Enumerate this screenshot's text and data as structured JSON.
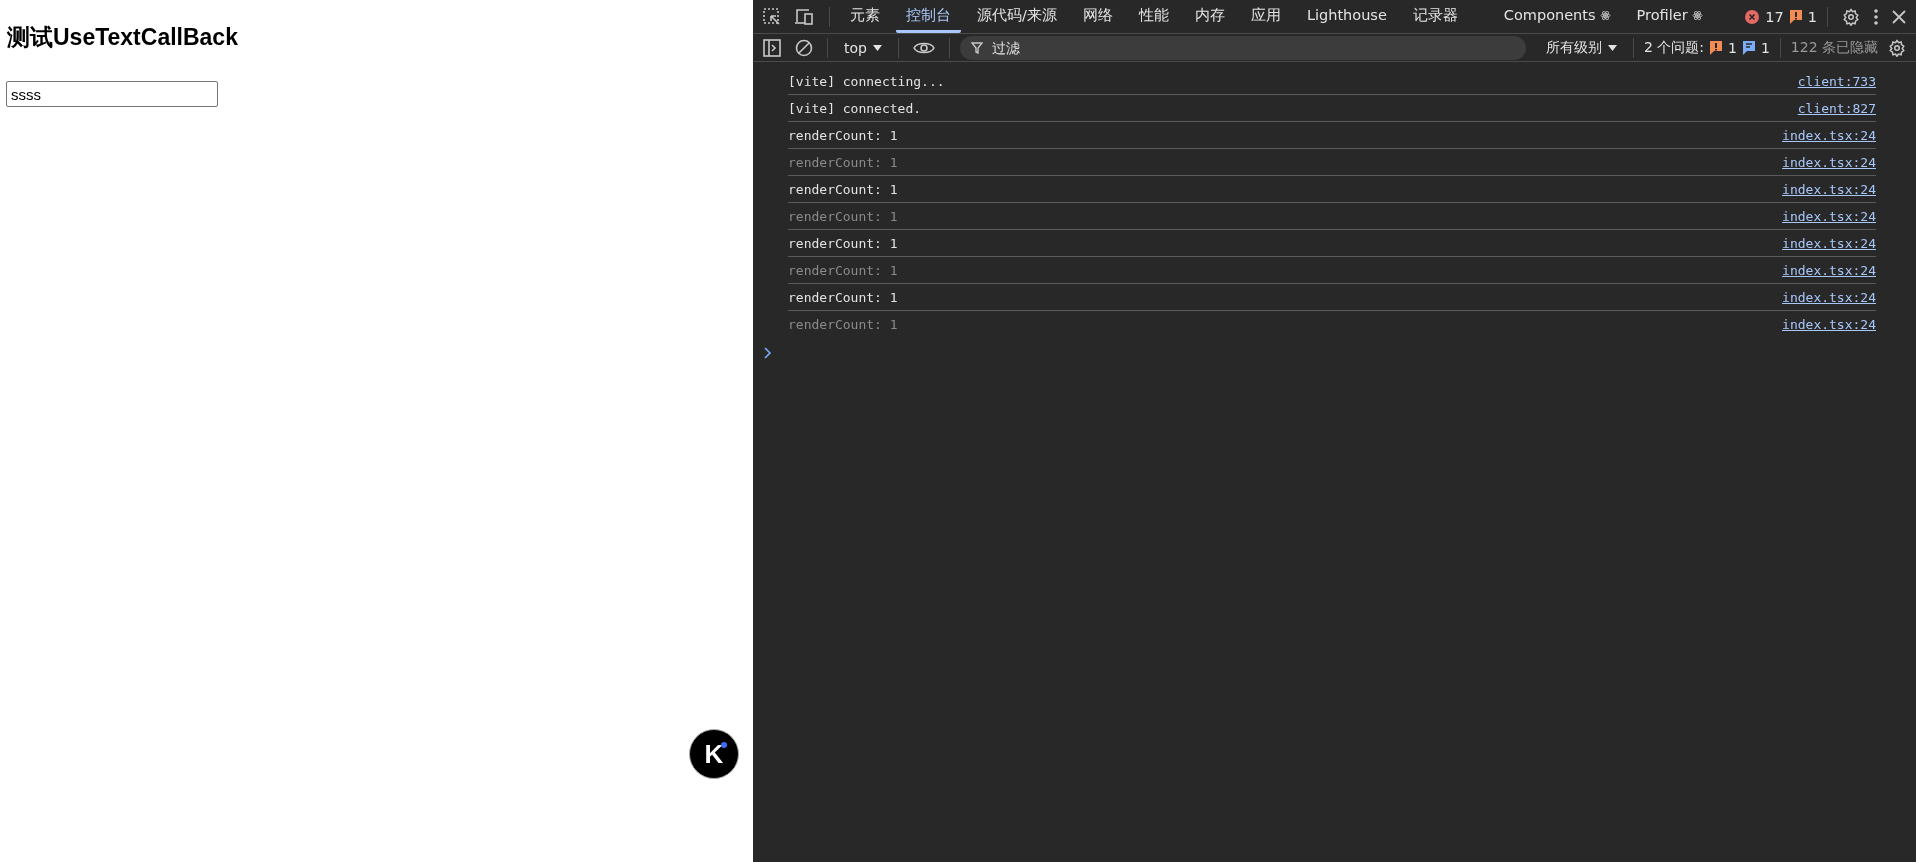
{
  "page": {
    "heading": "测试UseTextCallBack",
    "input_value": "ssss",
    "float_button": {
      "label": "K"
    }
  },
  "devtools": {
    "tabs": [
      {
        "label": "元素",
        "selected": false,
        "react": false
      },
      {
        "label": "控制台",
        "selected": true,
        "react": false
      },
      {
        "label": "源代码/来源",
        "selected": false,
        "react": false
      },
      {
        "label": "网络",
        "selected": false,
        "react": false
      },
      {
        "label": "性能",
        "selected": false,
        "react": false
      },
      {
        "label": "内存",
        "selected": false,
        "react": false
      },
      {
        "label": "应用",
        "selected": false,
        "react": false
      },
      {
        "label": "Lighthouse",
        "selected": false,
        "react": false
      },
      {
        "label": "记录器",
        "selected": false,
        "react": false
      },
      {
        "label": "Components",
        "selected": false,
        "react": true
      },
      {
        "label": "Profiler",
        "selected": false,
        "react": true
      }
    ],
    "error_count": "17",
    "warning_count": "1",
    "toolbar": {
      "context": "top",
      "filter_placeholder": "过滤",
      "levels": "所有级别",
      "issues_label": "2 个问题:",
      "issue_warnings": "1",
      "issue_info": "1",
      "hidden": "122 条已隐藏"
    },
    "messages": [
      {
        "text": "[vite] connecting...",
        "source": "client:733",
        "dimmed": false
      },
      {
        "text": "[vite] connected.",
        "source": "client:827",
        "dimmed": false
      },
      {
        "text": "renderCount: 1",
        "source": "index.tsx:24",
        "dimmed": false
      },
      {
        "text": "renderCount: 1",
        "source": "index.tsx:24",
        "dimmed": true
      },
      {
        "text": "renderCount: 1",
        "source": "index.tsx:24",
        "dimmed": false
      },
      {
        "text": "renderCount: 1",
        "source": "index.tsx:24",
        "dimmed": true
      },
      {
        "text": "renderCount: 1",
        "source": "index.tsx:24",
        "dimmed": false
      },
      {
        "text": "renderCount: 1",
        "source": "index.tsx:24",
        "dimmed": true
      },
      {
        "text": "renderCount: 1",
        "source": "index.tsx:24",
        "dimmed": false
      },
      {
        "text": "renderCount: 1",
        "source": "index.tsx:24",
        "dimmed": true
      }
    ]
  }
}
